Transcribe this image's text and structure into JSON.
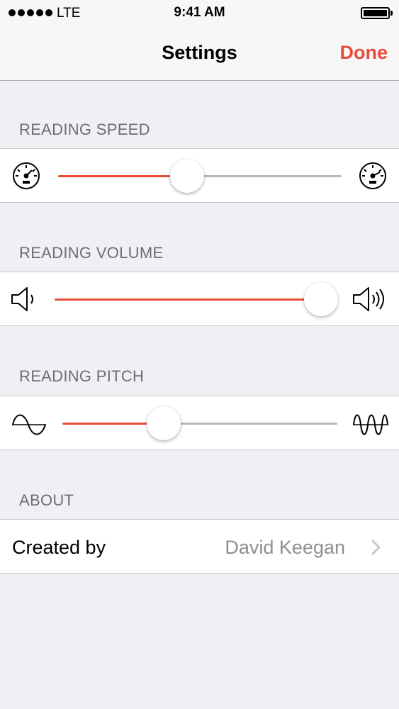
{
  "status_bar": {
    "carrier": "LTE",
    "time": "9:41 AM"
  },
  "nav": {
    "title": "Settings",
    "done_label": "Done"
  },
  "colors": {
    "accent": "#e74c3c",
    "track": "#b8b8bc",
    "background": "#efeff4"
  },
  "sections": {
    "speed": {
      "header": "READING SPEED",
      "value": 0.45,
      "min_icon": "speedometer-icon",
      "max_icon": "speedometer-icon"
    },
    "volume": {
      "header": "READING VOLUME",
      "value": 1.0,
      "min_icon": "speaker-low-icon",
      "max_icon": "speaker-high-icon"
    },
    "pitch": {
      "header": "READING PITCH",
      "value": 0.35,
      "min_icon": "wave-low-icon",
      "max_icon": "wave-high-icon"
    },
    "about": {
      "header": "ABOUT",
      "label": "Created by",
      "value": "David Keegan"
    }
  }
}
